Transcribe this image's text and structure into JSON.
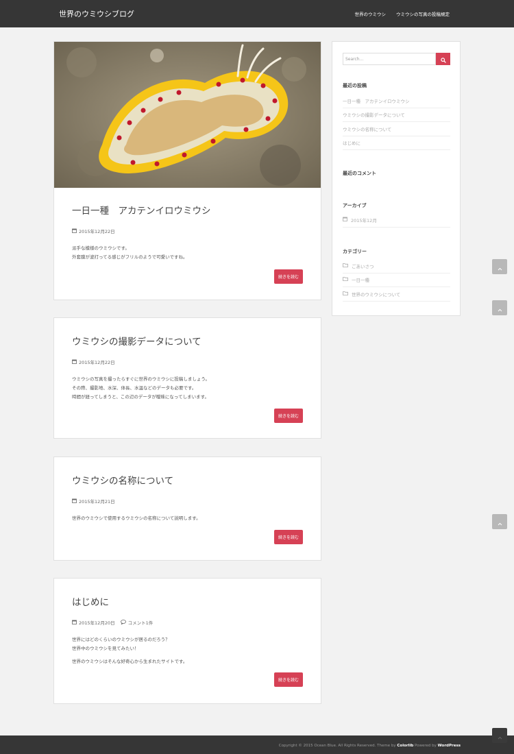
{
  "header": {
    "site_title": "世界のウミウシブログ",
    "nav": [
      "世界のウミウシ",
      "ウミウシの写真の投稿規定"
    ]
  },
  "posts": [
    {
      "title": "一日一種　アカテンイロウミウシ",
      "date": "2015年12月22日",
      "comment": "",
      "excerpt": [
        "派手な模様のウミウシです。",
        "外套膜が波打ってる感じがフリルのようで可愛いですね。"
      ],
      "read_more": "続きを読む"
    },
    {
      "title": "ウミウシの撮影データについて",
      "date": "2015年12月22日",
      "comment": "",
      "excerpt": [
        "ウミウシの写真を撮ったらすぐに世界のウミウシに投稿しましょう。",
        "その際、撮影地、水深、体長、水温などのデータも必要です。",
        "時間が経ってしまうと、この辺のデータが曖昧になってしまいます。"
      ],
      "read_more": "続きを読む"
    },
    {
      "title": "ウミウシの名称について",
      "date": "2015年12月21日",
      "comment": "",
      "excerpt": [
        "世界のウミウシで使用するウミウシの名称について説明します。"
      ],
      "read_more": "続きを読む"
    },
    {
      "title": "はじめに",
      "date": "2015年12月20日",
      "comment": "コメント1件",
      "excerpt": [
        "世界にはどのくらいのウミウシが居るのだろう？",
        "世界中のウミウシを見てみたい！",
        "世界のウミウシはそんな好奇心から生まれたサイトです。"
      ],
      "read_more": "続きを読む"
    }
  ],
  "sidebar": {
    "search_placeholder": "Search...",
    "recent_posts_title": "最近の投稿",
    "recent_posts": [
      "一日一種　アカテンイロウミウシ",
      "ウミウシの撮影データについて",
      "ウミウシの名称について",
      "はじめに"
    ],
    "recent_comments_title": "最近のコメント",
    "archives_title": "アーカイブ",
    "archives": [
      "2015年12月"
    ],
    "categories_title": "カテゴリー",
    "categories": [
      "ごあいさつ",
      "一日一種",
      "世界のウミウシについて"
    ]
  },
  "footer": {
    "copyright_prefix": "Copyright © 2015 Ocean Blue. All Rights Reserved. Theme by",
    "theme_link": "Colorlib",
    "powered_by": "Powered by",
    "wp_link": "WordPress"
  },
  "colors": {
    "accent": "#d64155",
    "header_bg": "#363636"
  },
  "icons": {
    "date": "calendar-icon",
    "comment": "comment-icon",
    "search": "search-icon",
    "folder": "folder-icon",
    "scroll": "chevron-up-icon"
  }
}
